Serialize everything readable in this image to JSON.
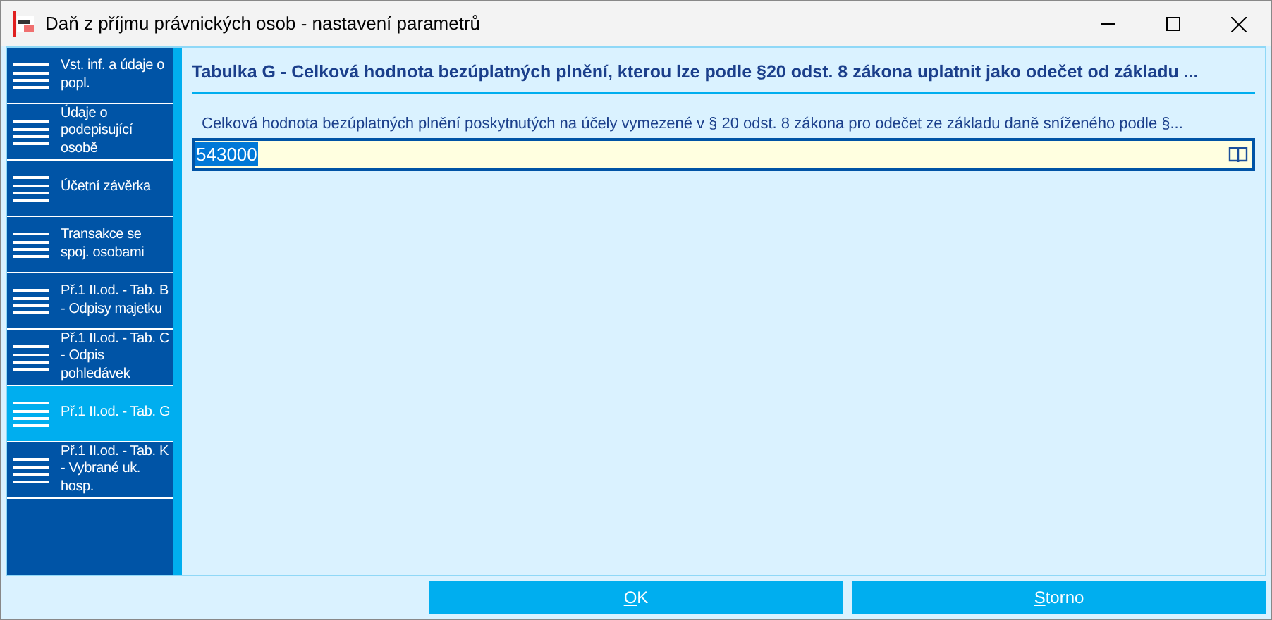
{
  "window": {
    "title": "Daň z příjmu právnických osob - nastavení parametrů"
  },
  "sidebar": {
    "items": [
      {
        "label": "Vst. inf. a údaje o popl.",
        "selected": false
      },
      {
        "label": "Údaje o podepisující osobě",
        "selected": false
      },
      {
        "label": "Účetní závěrka",
        "selected": false
      },
      {
        "label": "Transakce se spoj. osobami",
        "selected": false
      },
      {
        "label": "Př.1 II.od. - Tab. B - Odpisy majetku",
        "selected": false
      },
      {
        "label": "Př.1 II.od. - Tab. C - Odpis pohledávek",
        "selected": false
      },
      {
        "label": "Př.1 II.od. - Tab. G",
        "selected": true
      },
      {
        "label": "Př.1 II.od. - Tab. K - Vybrané uk. hosp.",
        "selected": false
      }
    ]
  },
  "section": {
    "title": "Tabulka G - Celková hodnota bezúplatných plnění, kterou lze podle §20 odst. 8 zákona uplatnit jako odečet od základu ...",
    "field": {
      "label": "Celková hodnota bezúplatných plnění poskytnutých na účely vymezené v § 20 odst. 8 zákona pro odečet ze základu daně sníženého podle §...",
      "value": "543000"
    }
  },
  "buttons": [
    {
      "label": "OK"
    },
    {
      "label": "Storno"
    }
  ]
}
